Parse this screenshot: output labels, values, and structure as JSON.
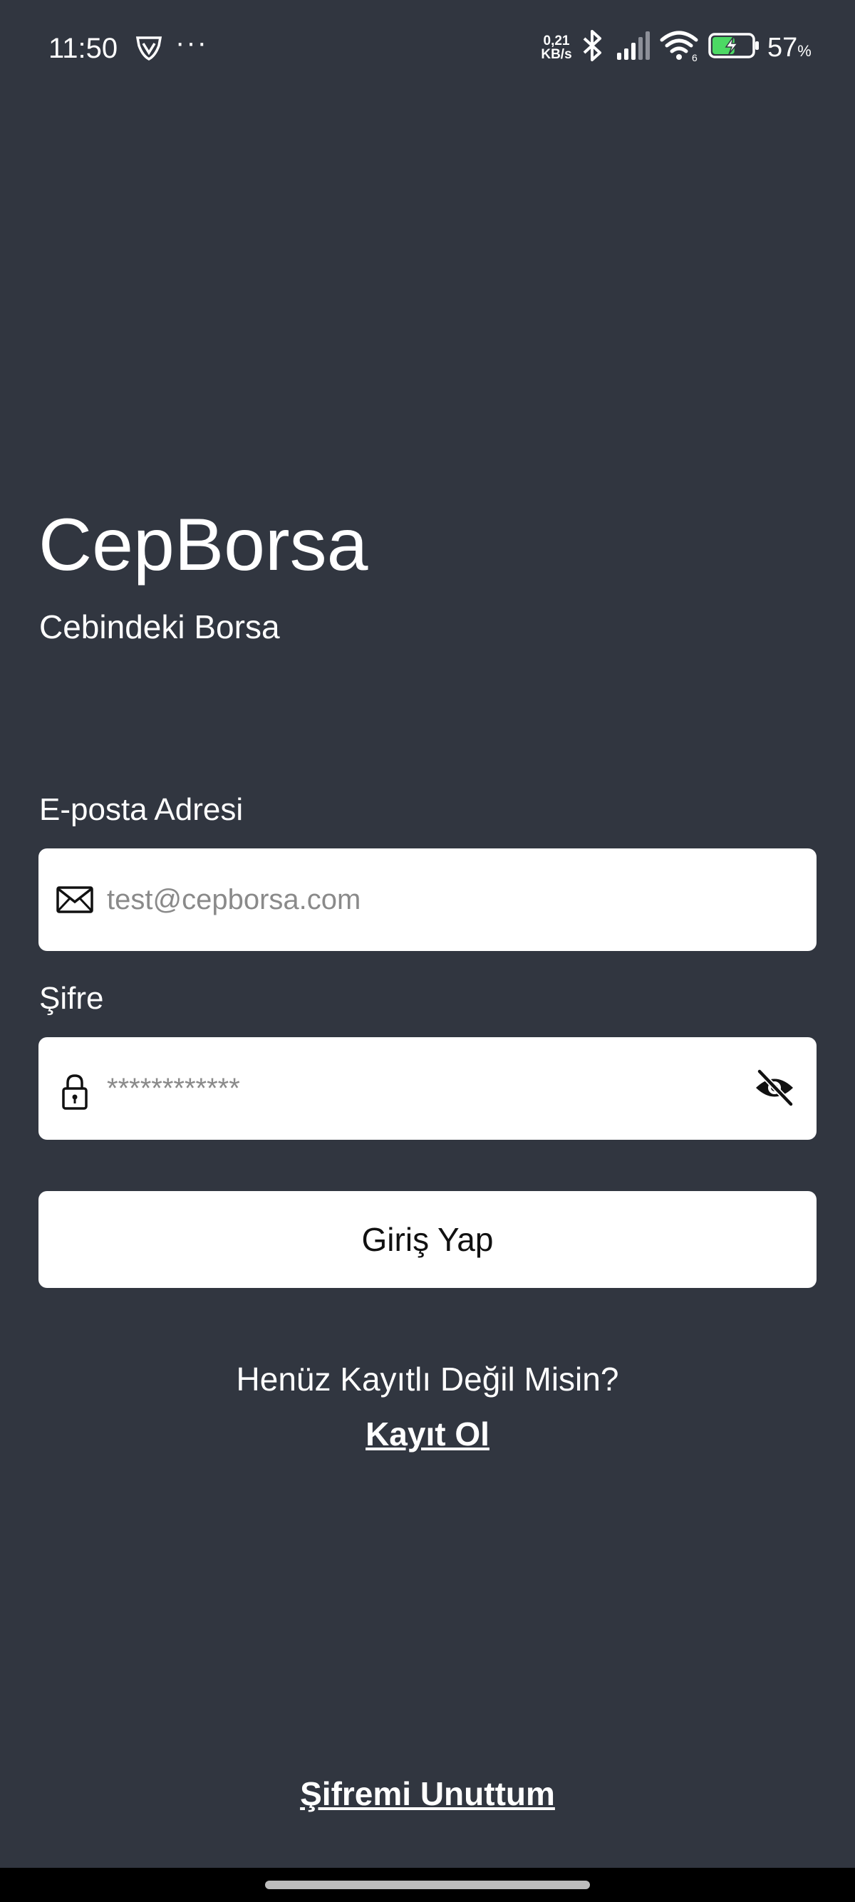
{
  "status_bar": {
    "time": "11:50",
    "dots": "···",
    "net_speed_value": "0,21",
    "net_speed_unit": "KB/s",
    "battery_percent": "57",
    "battery_percent_sign": "%",
    "battery_level": 0.57,
    "icons": [
      "shield-v-icon",
      "bluetooth-icon",
      "signal-icon",
      "wifi-icon",
      "battery-charging-icon"
    ]
  },
  "brand": {
    "title": "CepBorsa",
    "subtitle": "Cebindeki Borsa"
  },
  "form": {
    "email_label": "E-posta Adresi",
    "email_placeholder": "test@cepborsa.com",
    "email_icon": "mail-icon",
    "password_label": "Şifre",
    "password_placeholder": "************",
    "password_icon": "lock-icon",
    "visibility_icon": "eye-off-icon",
    "login_button": "Giriş Yap"
  },
  "register": {
    "prompt": "Henüz Kayıtlı Değil Misin?",
    "link": "Kayıt Ol"
  },
  "forgot_password": "Şifremi Unuttum",
  "colors": {
    "background": "#313640",
    "input_background": "#ffffff",
    "text": "#ffffff"
  }
}
